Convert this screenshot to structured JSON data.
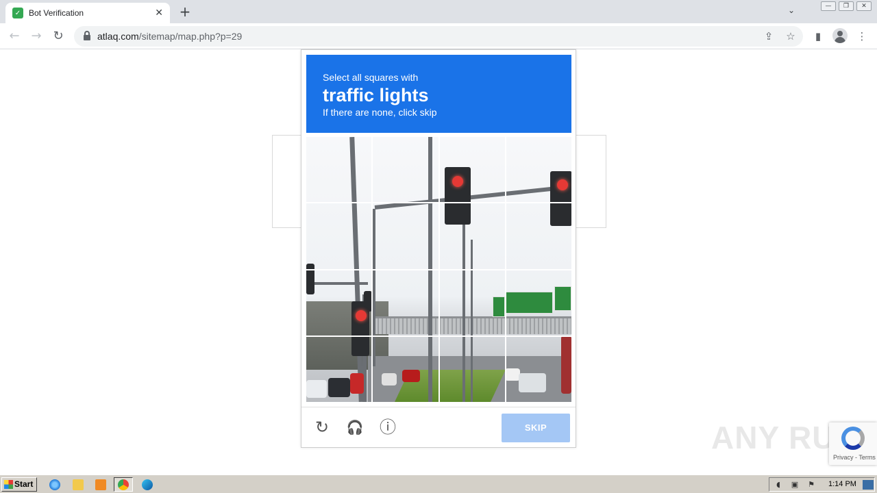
{
  "browser": {
    "tab_title": "Bot Verification",
    "tab_close": "✕",
    "new_tab": "+",
    "url_host": "atlaq.com",
    "url_path": "/sitemap/map.php?p=29",
    "back_glyph": "←",
    "forward_glyph": "→",
    "reload_glyph": "↻",
    "share_glyph": "⇪",
    "star_glyph": "☆",
    "sidepanel_glyph": "▮",
    "menu_glyph": "⋮",
    "tab_menu_glyph": "⌄",
    "win_min": "—",
    "win_restore": "❐",
    "win_close": "✕",
    "favicon_glyph": "✓"
  },
  "captcha": {
    "instruction_line1": "Select all squares with",
    "target_object": "traffic lights",
    "instruction_line3": "If there are none, click skip",
    "skip_label": "SKIP",
    "reload_glyph": "↻",
    "audio_glyph": "🎧",
    "info_glyph": "ⓘ",
    "grid_rows": 4,
    "grid_cols": 4,
    "header_color": "#1a73e8",
    "skip_color": "#a4c7f5"
  },
  "recaptcha_badge": {
    "text": "Privacy - Terms"
  },
  "watermark": {
    "text": "ANY RUN"
  },
  "taskbar": {
    "start_label": "Start",
    "clock": "1:14 PM",
    "apps": [
      "internet-explorer",
      "file-explorer",
      "media-player",
      "chrome",
      "edge"
    ]
  }
}
